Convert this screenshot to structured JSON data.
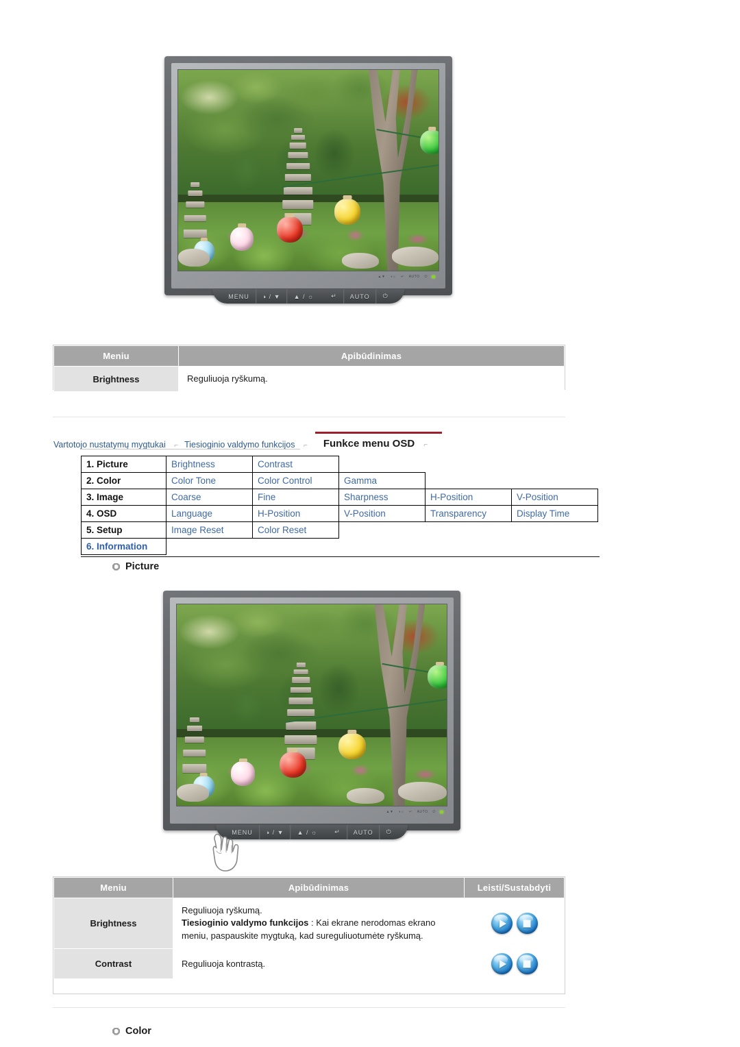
{
  "nav": {
    "tabs": [
      {
        "label": "Vartotojo nustatymų mygtukai",
        "active": false
      },
      {
        "label": "Tiesioginio valdymo funkcijos",
        "active": false
      },
      {
        "label": "Funkce menu OSD",
        "active": true
      }
    ],
    "separator": "⌐"
  },
  "monitor": {
    "buttons": [
      {
        "label": "MENU",
        "name": "menu-button"
      },
      {
        "label": "◑ / ▼",
        "name": "brightness-down-button"
      },
      {
        "label": "▲ / ☼",
        "name": "brightness-up-button"
      },
      {
        "label": "↵",
        "name": "enter-button"
      },
      {
        "label": "AUTO",
        "name": "auto-button"
      },
      {
        "label": "⏻",
        "name": "power-button"
      }
    ],
    "bezel_marks": [
      "▲▼",
      "◑☼",
      "↵",
      "AUTO",
      "⏻"
    ],
    "screen_alt": "Sodo vaizdas su pagoda ir spalvotais žibintais"
  },
  "table_top": {
    "headers": [
      "Meniu",
      "Apibūdinimas"
    ],
    "rows": [
      {
        "menu": "Brightness",
        "desc": "Reguliuoja ryškumą."
      }
    ]
  },
  "osd_menu": {
    "rows": [
      {
        "num": "1. Picture",
        "info": false,
        "items": [
          "Brightness",
          "Contrast"
        ]
      },
      {
        "num": "2. Color",
        "info": false,
        "items": [
          "Color Tone",
          "Color Control",
          "Gamma"
        ]
      },
      {
        "num": "3. Image",
        "info": false,
        "items": [
          "Coarse",
          "Fine",
          "Sharpness",
          "H-Position",
          "V-Position"
        ]
      },
      {
        "num": "4. OSD",
        "info": false,
        "items": [
          "Language",
          "H-Position",
          "V-Position",
          "Transparency",
          "Display Time"
        ]
      },
      {
        "num": "5. Setup",
        "info": false,
        "items": [
          "Image Reset",
          "Color Reset"
        ]
      },
      {
        "num": "6. Information",
        "info": true,
        "items": []
      }
    ]
  },
  "section_picture": {
    "label": "Picture"
  },
  "section_color": {
    "label": "Color"
  },
  "table_bottom": {
    "headers": [
      "Meniu",
      "Apibūdinimas",
      "Leisti/Sustabdyti"
    ],
    "rows": [
      {
        "menu": "Brightness",
        "line1": "Reguliuoja ryškumą.",
        "bold": "Tiesioginio valdymo funkcijos",
        "rest": " : Kai ekrane nerodomas ekrano meniu, paspauskite mygtuką, kad sureguliuotumėte ryškumą.",
        "icons": [
          "play",
          "stop"
        ]
      },
      {
        "menu": "Contrast",
        "line1": "Reguliuoja kontrastą.",
        "bold": "",
        "rest": "",
        "icons": [
          "play",
          "stop"
        ]
      }
    ]
  },
  "colors": {
    "header_bg": "#a5a5a5",
    "menu_cell_bg": "#e2e2e2",
    "link_blue": "#3f6aa5",
    "active_tab_accent": "#9d1f2b",
    "icon_blue": "#1a72c0"
  }
}
